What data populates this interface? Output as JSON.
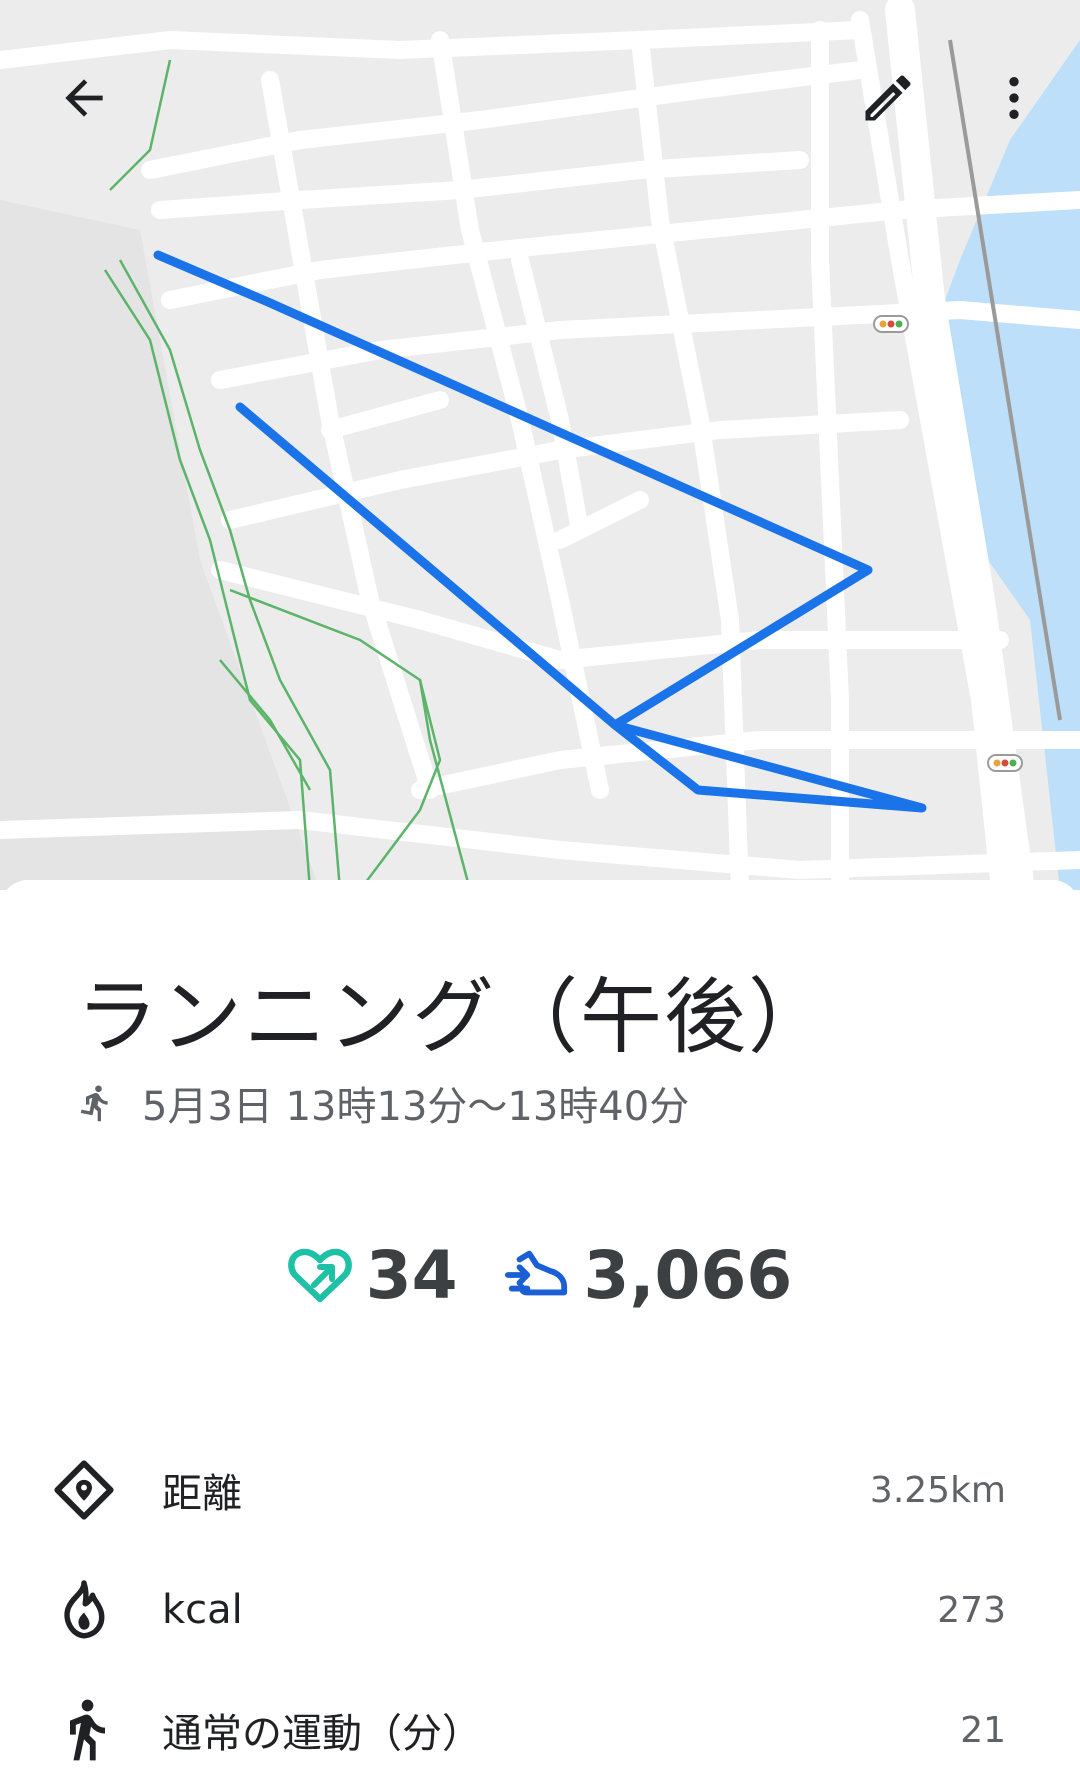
{
  "map": {
    "route_color": "#1a73e8",
    "path_color": "#5cb46a",
    "water_color": "#aadaff"
  },
  "toolbar": {
    "back": "back-arrow-icon",
    "edit": "pencil-icon",
    "more": "more-vert-icon"
  },
  "activity": {
    "title": "ランニング（午後）",
    "time_range": "5月3日 13時13分〜13時40分",
    "type_icon": "running-icon"
  },
  "stats": {
    "heart_points": "34",
    "steps": "3,066",
    "heart_color": "#1ec0a6",
    "steps_color": "#1a5fd6"
  },
  "metrics": [
    {
      "icon": "location-diamond-icon",
      "label": "距離",
      "value": "3.25km"
    },
    {
      "icon": "flame-icon",
      "label": "kcal",
      "value": "273"
    },
    {
      "icon": "walking-icon",
      "label": "通常の運動（分）",
      "value": "21"
    }
  ]
}
